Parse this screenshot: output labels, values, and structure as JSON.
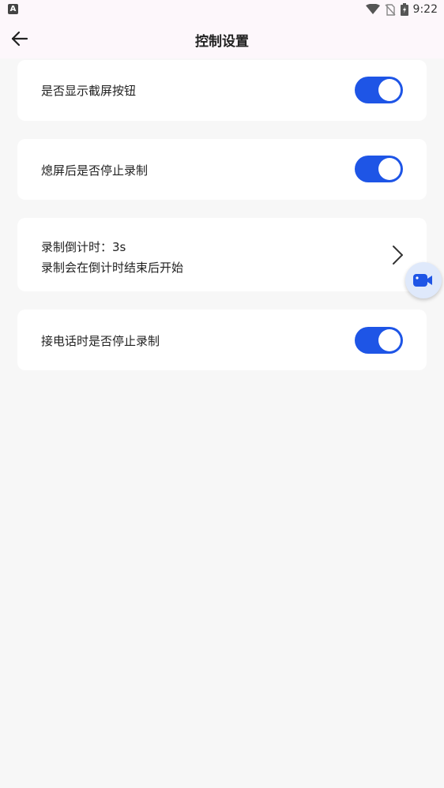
{
  "status_bar": {
    "time": "9:22",
    "left_icon": "A"
  },
  "header": {
    "title": "控制设置"
  },
  "settings": [
    {
      "label": "是否显示截屏按钮",
      "enabled": true
    },
    {
      "label": "熄屏后是否停止录制",
      "enabled": true
    },
    {
      "label": "录制倒计时：3s",
      "sublabel": "录制会在倒计时结束后开始"
    },
    {
      "label": "接电话时是否停止录制",
      "enabled": true
    }
  ],
  "colors": {
    "accent": "#1e55e6",
    "app_bar_bg": "#fdf7fb",
    "page_bg": "#f7f7f7"
  }
}
